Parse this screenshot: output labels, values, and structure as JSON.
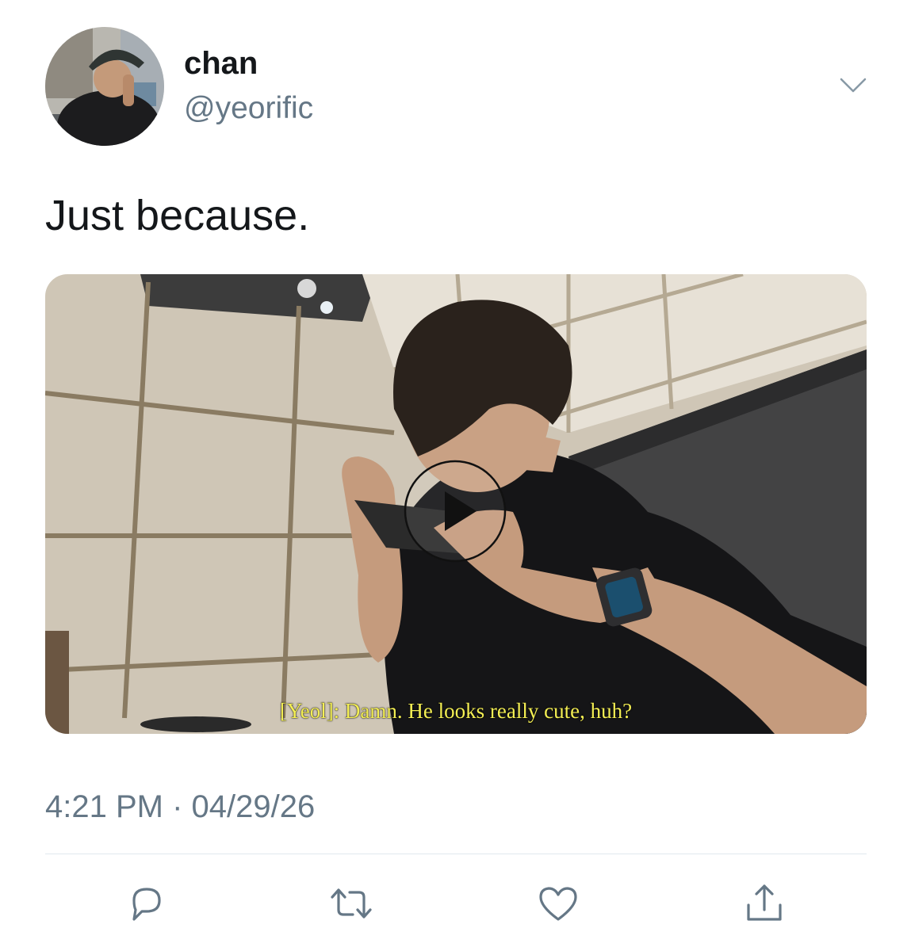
{
  "tweet": {
    "display_name": "chan",
    "handle": "@yeorific",
    "text": "Just because.",
    "timestamp": "4:21 PM · 04/29/26"
  },
  "media": {
    "type": "video",
    "subtitle": "[Yeol]: Damn. He looks really cute, huh?"
  },
  "icons": {
    "caret": "chevron-down-icon",
    "reply": "reply-icon",
    "retweet": "retweet-icon",
    "like": "heart-icon",
    "share": "share-icon",
    "play": "play-icon"
  },
  "colors": {
    "text_primary": "#14171a",
    "text_secondary": "#657786",
    "divider": "#e1e8ed",
    "subtitle": "#f4ef54"
  }
}
